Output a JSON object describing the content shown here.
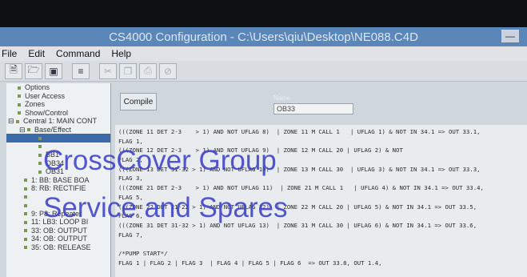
{
  "window": {
    "title": "CS4000 Configuration - C:\\Users\\qiu\\Desktop\\NE088.C4D"
  },
  "menu": {
    "items": [
      "File",
      "Edit",
      "Command",
      "Help"
    ]
  },
  "toolbar": {
    "buttons": [
      "new-icon",
      "open-icon",
      "save-icon",
      "insert-icon",
      "cut-icon",
      "copy-icon",
      "paste-icon",
      "delete-icon"
    ]
  },
  "tree": {
    "items": [
      "Options",
      "User Access",
      "Zones",
      "Show/Control",
      "Central 1: MAIN CONT",
      "Base/Effect",
      "",
      "",
      "BB1",
      "OB34",
      "OB31",
      "1: BB: BASE BOA",
      "8: RB: RECTIFIE",
      "",
      "",
      "9: P8: Repeater",
      "11: LB3: LOOP BI",
      "33: OB: OUTPUT",
      "34: OB: OUTPUT",
      "35: OB: RELEASE"
    ]
  },
  "editor": {
    "compile_label": "Compile",
    "name_label": "Name",
    "name_value": "OB33",
    "code_lines": [
      "(((ZONE 11 DET 2-3    > 1) AND NOT UFLAG 8)  | ZONE 11 M CALL 1   | UFLAG 1) & NOT IN 34.1 => OUT 33.1,",
      "FLAG 1,",
      "(((ZONE 12 DET 2-3    > 1) AND NOT UFLAG 9)  | ZONE 12 M CALL 20 | UFLAG 2) & NOT",
      "FLAG 2,",
      "(((ZONE 13 DET 31-32 > 1) AND NOT UFLAG 10)  | ZONE 13 M CALL 30  | UFLAG 3) & NOT IN 34.1 => OUT 33.3,",
      "FLAG 3,",
      "(((ZONE 21 DET 2-3    > 1) AND NOT UFLAG 11)  | ZONE 21 M CALL 1   | UFLAG 4) & NOT IN 34.1 => OUT 33.4,",
      "FLAG 5,",
      "(((ZONE 22 DET 21-22 > 1) AND NOT UFLAG 12)  | ZONE 22 M CALL 20 | UFLAG 5) & NOT IN 34.1 => OUT 33.5,",
      "FLAG 6,",
      "(((ZONE 31 DET 31-32 > 1) AND NOT UFLAG 13)  | ZONE 31 M CALL 30 | UFLAG 6) & NOT IN 34.1 => OUT 33.6,",
      "FLAG 7,",
      "",
      "/*PUMP START*/",
      "FLAG 1 | FLAG 2 | FLAG 3  | FLAG 4 | FLAG 5 | FLAG 6  => OUT 33.8, OUT 1.4,"
    ]
  },
  "watermark": {
    "line1": "CrossCover Group",
    "line2": "Service and Spares"
  }
}
